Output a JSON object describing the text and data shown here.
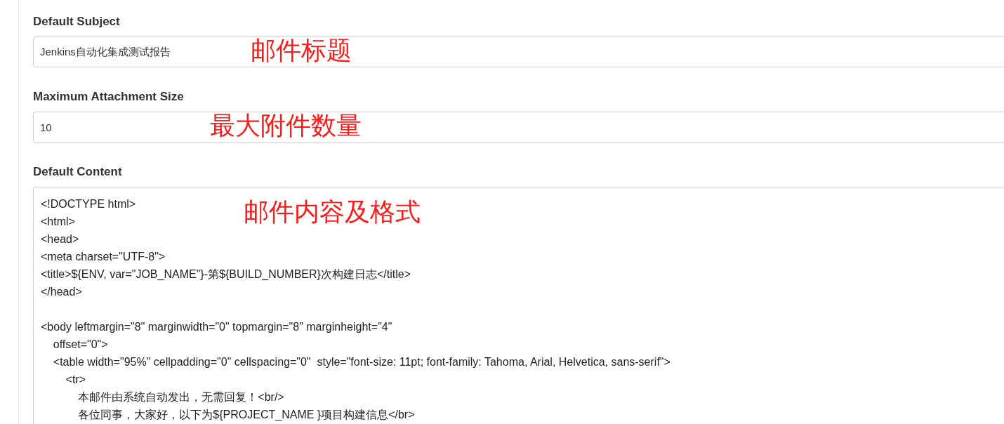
{
  "fields": [
    {
      "kind": "input",
      "label": "Default Subject",
      "value": "Jenkins自动化集成测试报告",
      "annotation": "邮件标题"
    },
    {
      "kind": "input",
      "label": "Maximum Attachment Size",
      "value": "10",
      "annotation": "最大附件数量"
    },
    {
      "kind": "textarea",
      "label": "Default Content",
      "annotation": "邮件内容及格式",
      "blocks": [
        [
          "<!DOCTYPE html>",
          "<html>",
          "<head>",
          "<meta charset=\"UTF-8\">",
          "<title>${ENV, var=\"JOB_NAME\"}-第${BUILD_NUMBER}次构建日志</title>",
          "</head>"
        ],
        [
          "<body leftmargin=\"8\" marginwidth=\"0\" topmargin=\"8\" marginheight=\"4\"",
          "    offset=\"0\">",
          "    <table width=\"95%\" cellpadding=\"0\" cellspacing=\"0\"  style=\"font-size: 11pt; font-family: Tahoma, Arial, Helvetica, sans-serif\">",
          "        <tr>",
          "            本邮件由系统自动发出，无需回复！<br/>",
          "            各位同事，大家好，以下为${PROJECT_NAME }项目构建信息</br>"
        ]
      ]
    }
  ]
}
